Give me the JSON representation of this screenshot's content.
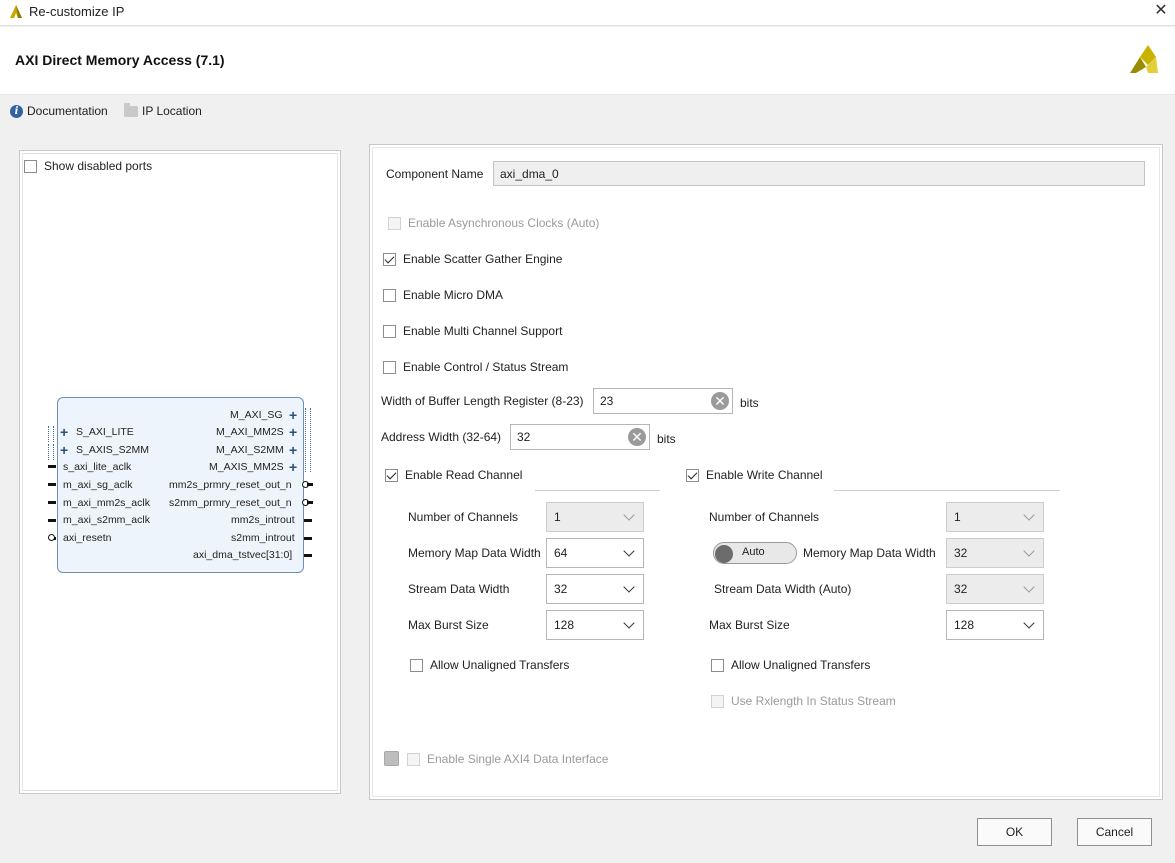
{
  "window": {
    "title": "Re-customize IP",
    "close_glyph": "✕",
    "app_icon": "vivado-logo-icon"
  },
  "header": {
    "ip_title": "AXI Direct Memory Access (7.1)",
    "brand_icon": "xilinx-logo-icon"
  },
  "links": {
    "documentation": "Documentation",
    "ip_location": "IP Location",
    "info_glyph": "i"
  },
  "left_panel": {
    "show_disabled_ports": {
      "label": "Show disabled ports",
      "checked": false
    },
    "block": {
      "left_ports": [
        "S_AXI_LITE",
        "S_AXIS_S2MM",
        "s_axi_lite_aclk",
        "m_axi_sg_aclk",
        "m_axi_mm2s_aclk",
        "m_axi_s2mm_aclk",
        "axi_resetn"
      ],
      "right_ports": [
        "M_AXI_SG",
        "M_AXI_MM2S",
        "M_AXI_S2MM",
        "M_AXIS_MM2S",
        "mm2s_prmry_reset_out_n",
        "s2mm_prmry_reset_out_n",
        "mm2s_introut",
        "s2mm_introut",
        "axi_dma_tstvec[31:0]"
      ]
    }
  },
  "form": {
    "component_name_label": "Component Name",
    "component_name_value": "axi_dma_0",
    "enable_async_clocks": {
      "label": "Enable Asynchronous Clocks (Auto)",
      "checked": false,
      "disabled": true
    },
    "enable_sg_engine": {
      "label": "Enable Scatter Gather Engine",
      "checked": true
    },
    "enable_micro_dma": {
      "label": "Enable Micro DMA",
      "checked": false
    },
    "enable_multi_channel": {
      "label": "Enable Multi Channel Support",
      "checked": false
    },
    "enable_ctrl_status": {
      "label": "Enable Control / Status Stream",
      "checked": false
    },
    "buffer_len_label": "Width of Buffer Length Register (8-23)",
    "buffer_len_value": "23",
    "buffer_len_unit": "bits",
    "addr_width_label": "Address Width (32-64)",
    "addr_width_value": "32",
    "addr_width_unit": "bits",
    "clear_glyph": "✕",
    "read_channel": {
      "enable": {
        "label": "Enable Read Channel",
        "checked": true
      },
      "num_channels_label": "Number of Channels",
      "num_channels_value": "1",
      "mm_data_width_label": "Memory Map Data Width",
      "mm_data_width_value": "64",
      "stream_data_width_label": "Stream Data Width",
      "stream_data_width_value": "32",
      "max_burst_label": "Max Burst Size",
      "max_burst_value": "128",
      "allow_unaligned": {
        "label": "Allow Unaligned Transfers",
        "checked": false
      }
    },
    "write_channel": {
      "enable": {
        "label": "Enable Write Channel",
        "checked": true
      },
      "num_channels_label": "Number of Channels",
      "num_channels_value": "1",
      "auto_toggle_label": "Auto",
      "mm_data_width_label": "Memory Map Data Width",
      "mm_data_width_value": "32",
      "stream_data_width_label": "Stream Data Width (Auto)",
      "stream_data_width_value": "32",
      "max_burst_label": "Max Burst Size",
      "max_burst_value": "128",
      "allow_unaligned": {
        "label": "Allow Unaligned Transfers",
        "checked": false
      },
      "use_rxlength": {
        "label": "Use Rxlength In Status Stream",
        "checked": false,
        "disabled": true
      }
    },
    "single_axi4": {
      "label": "Enable Single AXI4 Data Interface",
      "checked": false,
      "disabled": true
    }
  },
  "buttons": {
    "ok": "OK",
    "cancel": "Cancel"
  },
  "colors": {
    "block_fill": "#eef4fc",
    "block_border": "#6f8fb8",
    "info_blue": "#3163a0",
    "brand_yellow": "#c8b400"
  }
}
